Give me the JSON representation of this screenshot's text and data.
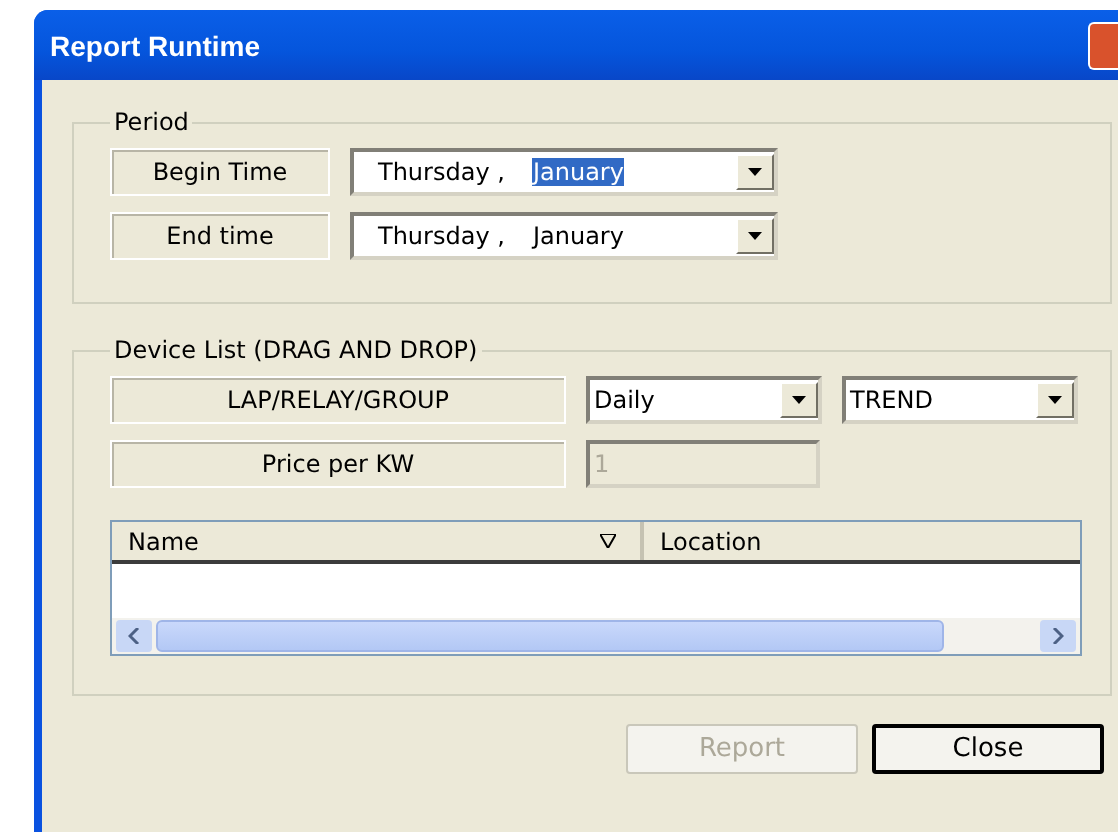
{
  "window": {
    "title": "Report Runtime"
  },
  "period": {
    "title": "Period",
    "rows": [
      {
        "label": "Begin Time",
        "day": "Thursday",
        "sep": ",",
        "month": "January",
        "month_selected": true
      },
      {
        "label": "End time",
        "day": "Thursday",
        "sep": ",",
        "month": "January",
        "month_selected": false
      }
    ]
  },
  "device_list": {
    "title": "Device List (DRAG AND DROP)",
    "type_label": "LAP/RELAY/GROUP",
    "interval": "Daily",
    "mode": "TREND",
    "price_label": "Price per KW",
    "price_value": "1",
    "price_disabled": true,
    "table": {
      "columns": [
        {
          "label": "Name",
          "sorted": true
        },
        {
          "label": "Location",
          "sorted": false
        }
      ]
    }
  },
  "buttons": [
    {
      "label": "Report",
      "disabled": true,
      "default": false
    },
    {
      "label": "Close",
      "disabled": false,
      "default": true
    }
  ]
}
